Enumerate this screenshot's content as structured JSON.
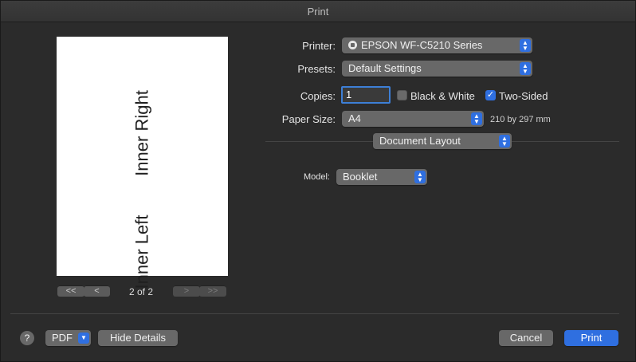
{
  "window": {
    "title": "Print"
  },
  "preview": {
    "top_label": "Inner Right",
    "bottom_label": "Inner Left",
    "page_indicator": "2 of 2",
    "nav": {
      "first": "<<",
      "prev": "<",
      "next": ">",
      "last": ">>"
    }
  },
  "form": {
    "printer_label": "Printer:",
    "printer_value": "EPSON WF-C5210 Series",
    "presets_label": "Presets:",
    "presets_value": "Default Settings",
    "copies_label": "Copies:",
    "copies_value": "1",
    "black_white_label": "Black & White",
    "black_white_checked": false,
    "two_sided_label": "Two-Sided",
    "two_sided_checked": true,
    "paper_size_label": "Paper Size:",
    "paper_size_value": "A4",
    "paper_size_dims": "210 by 297 mm",
    "section_value": "Document Layout",
    "model_label": "Model:",
    "model_value": "Booklet"
  },
  "footer": {
    "help": "?",
    "pdf": "PDF",
    "hide_details": "Hide Details",
    "cancel": "Cancel",
    "print": "Print"
  },
  "colors": {
    "accent": "#2f6fe0",
    "background": "#2b2b2b",
    "control": "#686868"
  }
}
